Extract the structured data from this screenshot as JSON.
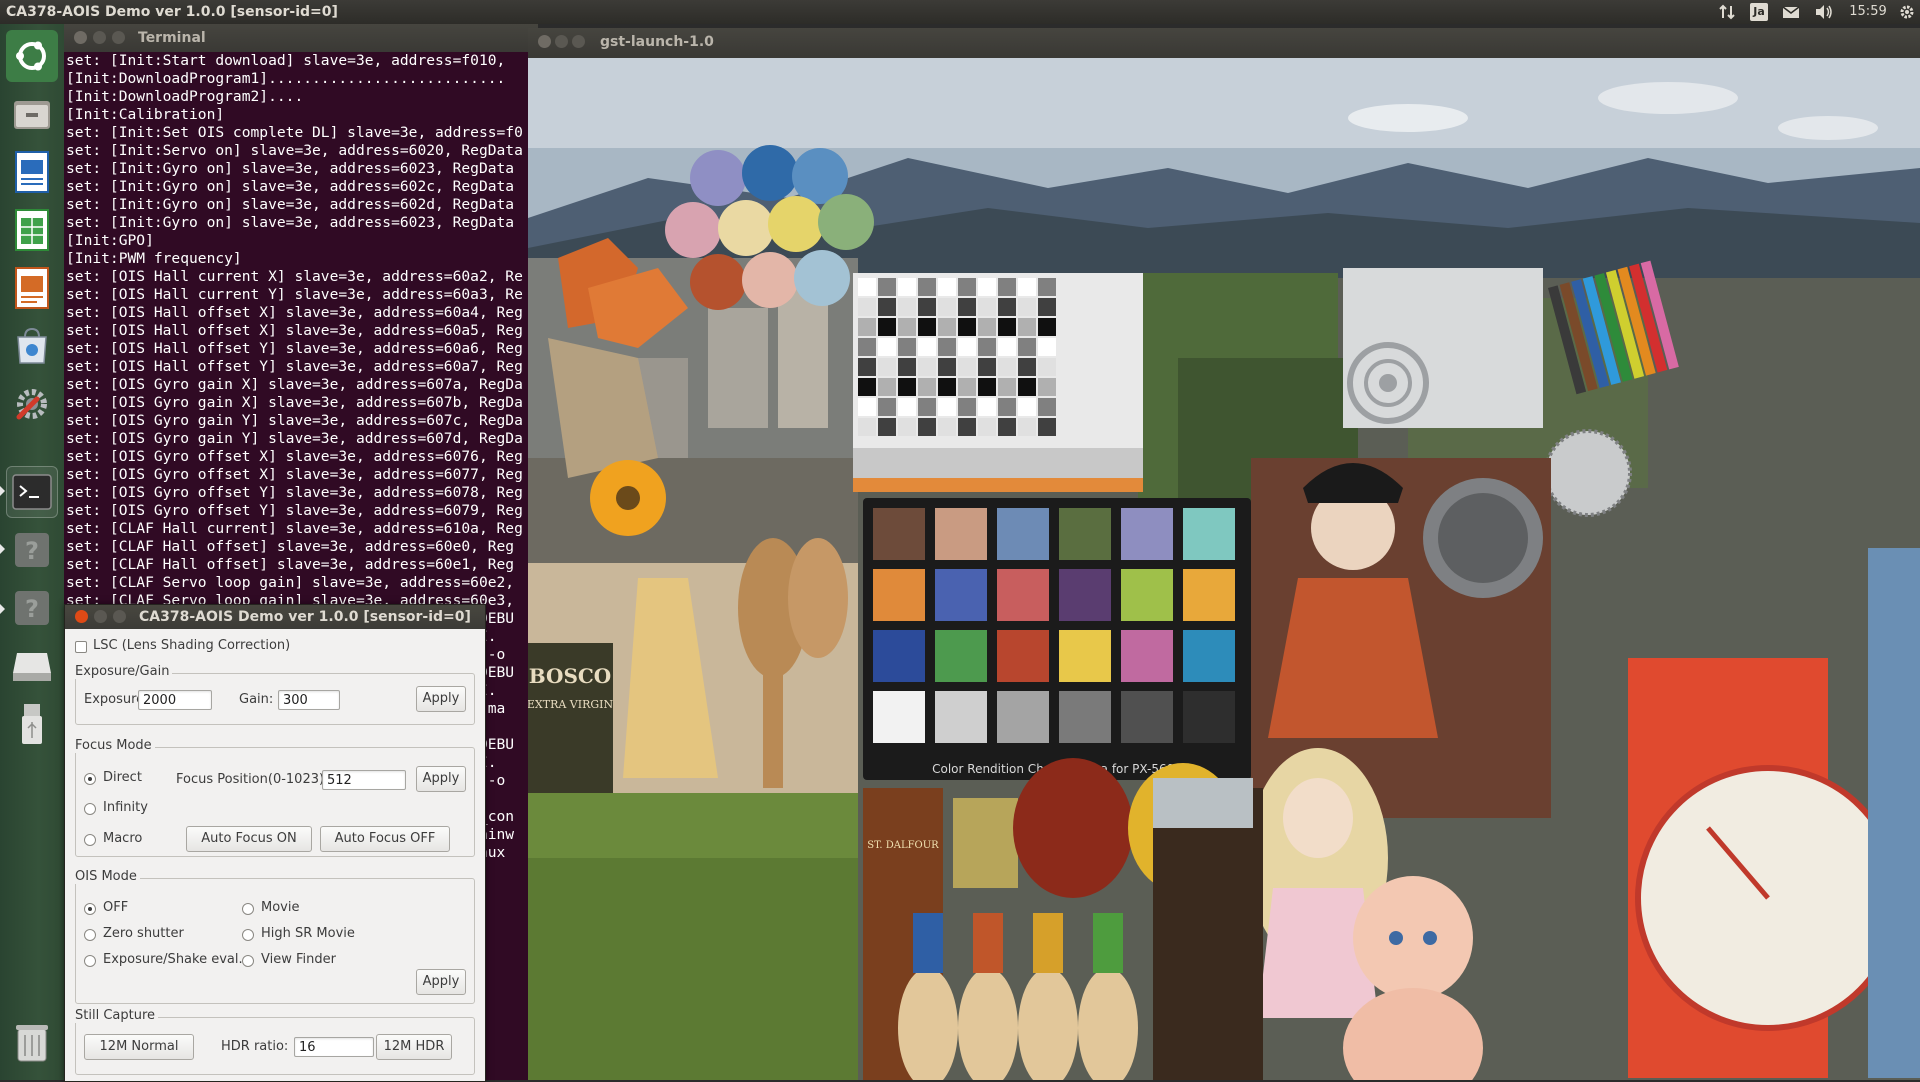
{
  "topbar": {
    "app_title": "CA378-AOIS  Demo  ver 1.0.0  [sensor-id=0]",
    "keyboard_layout": "Ja",
    "clock": "15:59"
  },
  "launcher": {
    "items": [
      "ubuntu-home-icon",
      "file-manager-icon",
      "writer-icon",
      "calc-icon",
      "impress-icon",
      "software-center-icon",
      "system-settings-icon",
      "terminal-icon",
      "unknown-app-icon",
      "unknown-app-icon",
      "drive-icon",
      "usb-drive-icon",
      "trash-icon"
    ]
  },
  "terminal": {
    "title": "Terminal",
    "lines": [
      "set: [Init:Start download] slave=3e, address=f010,",
      "[Init:DownloadProgram1]...........................",
      "[Init:DownloadProgram2]....",
      "[Init:Calibration]",
      "set: [Init:Set OIS complete DL] slave=3e, address=f0",
      "set: [Init:Servo on] slave=3e, address=6020, RegData",
      "set: [Init:Gyro on] slave=3e, address=6023, RegData",
      "set: [Init:Gyro on] slave=3e, address=602c, RegData",
      "set: [Init:Gyro on] slave=3e, address=602d, RegData",
      "set: [Init:Gyro on] slave=3e, address=6023, RegData",
      "[Init:GPO]",
      "[Init:PWM frequency]",
      "set: [OIS Hall current X] slave=3e, address=60a2, Re",
      "set: [OIS Hall current Y] slave=3e, address=60a3, Re",
      "set: [OIS Hall offset X] slave=3e, address=60a4, Reg",
      "set: [OIS Hall offset X] slave=3e, address=60a5, Reg",
      "set: [OIS Hall offset Y] slave=3e, address=60a6, Reg",
      "set: [OIS Hall offset Y] slave=3e, address=60a7, Reg",
      "set: [OIS Gyro gain X] slave=3e, address=607a, RegDa",
      "set: [OIS Gyro gain X] slave=3e, address=607b, RegDa",
      "set: [OIS Gyro gain Y] slave=3e, address=607c, RegDa",
      "set: [OIS Gyro gain Y] slave=3e, address=607d, RegDa",
      "set: [OIS Gyro offset X] slave=3e, address=6076, Reg",
      "set: [OIS Gyro offset X] slave=3e, address=6077, Reg",
      "set: [OIS Gyro offset Y] slave=3e, address=6078, Reg",
      "set: [OIS Gyro offset Y] slave=3e, address=6079, Reg",
      "set: [CLAF Hall current] slave=3e, address=610a, Reg",
      "set: [CLAF Hall offset] slave=3e, address=60e0, Reg",
      "set: [CLAF Hall offset] slave=3e, address=60e1, Reg",
      "set: [CLAF Servo loop gain] slave=3e, address=60e2,",
      "set: [CLAF Servo loop gain] slave=3e, address=60e3,",
      "                                              _DEBU",
      "                                              -I.",
      "                                              . -o",
      "                                              _DEBU",
      "                                              -I.",
      "                                              . ma",
      "",
      "                                              _DEBU",
      "                                              -I.",
      "                                              . -o",
      "",
      "                                              o_con",
      "                                              nainw",
      "                                              inux"
    ]
  },
  "viewer": {
    "title": "gst-launch-1.0",
    "chart_caption": "Color Rendition Chart Replica for PX-5600",
    "olive_label": "BOSCO",
    "olive_sublabel": "EXTRA VIRGIN",
    "jar_label": "ST. DALFOUR"
  },
  "dialog": {
    "title": "CA378-AOIS  Demo  ver 1.0.0  [sensor-id=0]",
    "lsc_label": "LSC (Lens Shading Correction)",
    "exposure_gain": {
      "group_label": "Exposure/Gain",
      "exposure_label": "Exposure:",
      "exposure_value": "2000",
      "gain_label": "Gain:",
      "gain_value": "300",
      "apply_label": "Apply"
    },
    "focus": {
      "group_label": "Focus Mode",
      "direct_label": "Direct",
      "infinity_label": "Infinity",
      "macro_label": "Macro",
      "position_label": "Focus Position(0-1023):",
      "position_value": "512",
      "apply_label": "Apply",
      "af_on_label": "Auto Focus ON",
      "af_off_label": "Auto Focus OFF"
    },
    "ois": {
      "group_label": "OIS Mode",
      "off_label": "OFF",
      "zero_shutter_label": "Zero shutter",
      "exposure_shake_label": "Exposure/Shake eval.",
      "movie_label": "Movie",
      "high_sr_movie_label": "High SR Movie",
      "view_finder_label": "View Finder",
      "apply_label": "Apply"
    },
    "still": {
      "group_label": "Still Capture",
      "normal_label": "12M Normal",
      "hdr_ratio_label": "HDR ratio:",
      "hdr_ratio_value": "16",
      "hdr_label": "12M HDR"
    }
  }
}
